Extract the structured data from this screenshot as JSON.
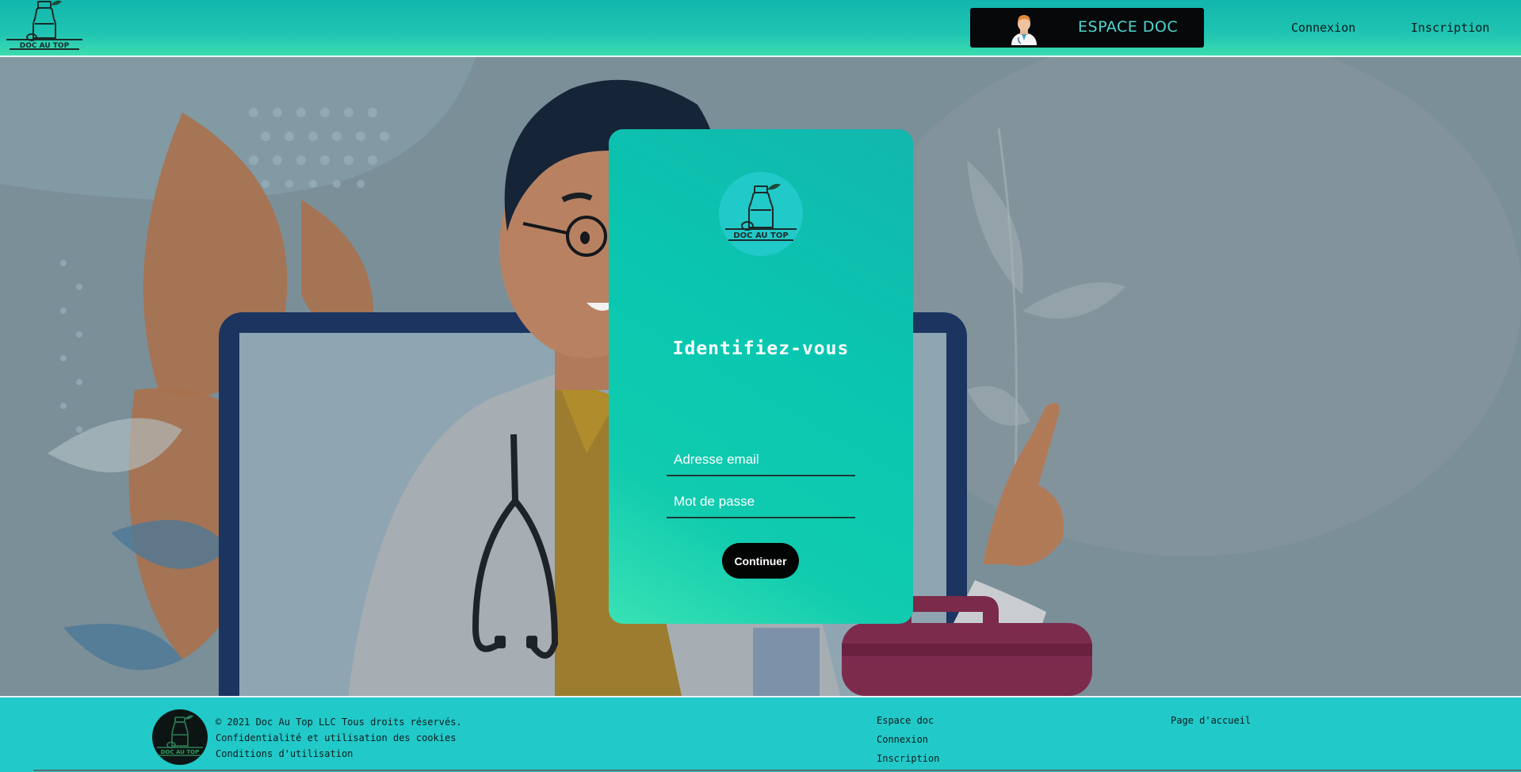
{
  "header": {
    "logo_text": "DOC AU TOP",
    "espace_doc_label": "ESPACE DOC",
    "nav": {
      "connexion": "Connexion",
      "inscription": "Inscription"
    }
  },
  "login": {
    "logo_text": "DOC AU TOP",
    "title": "Identifiez-vous",
    "email_placeholder": "Adresse email",
    "password_placeholder": "Mot de passe",
    "continue_label": "Continuer"
  },
  "footer": {
    "logo_text": "DOC AU TOP",
    "copyright": "© 2021 Doc Au Top LLC Tous droits réservés.",
    "cookies": "Confidentialité et utilisation des cookies",
    "terms": "Conditions d'utilisation",
    "links": {
      "espace_doc": "Espace doc",
      "connexion": "Connexion",
      "inscription": "Inscription",
      "accueil": "Page d'accueil"
    }
  },
  "colors": {
    "teal_primary": "#12b7ad",
    "teal_light": "#39e2b4",
    "footer_bg": "#22c9c9",
    "espace_doc_bg": "#06080a",
    "espace_doc_text": "#4fd6cf",
    "button_bg": "#020303"
  },
  "icons": {
    "logo": "medicine-bottle-logo",
    "doctor_avatar": "doctor-avatar-icon"
  }
}
